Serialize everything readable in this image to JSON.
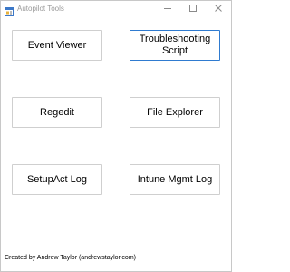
{
  "window": {
    "title": "Autopilot Tools"
  },
  "buttons": {
    "event_viewer": "Event Viewer",
    "troubleshooting_script": "Troubleshooting Script",
    "regedit": "Regedit",
    "file_explorer": "File Explorer",
    "setupact_log": "SetupAct Log",
    "intune_mgmt_log": "Intune Mgmt Log"
  },
  "footer": {
    "credit": "Created by Andrew Taylor (andrewstaylor.com)"
  },
  "colors": {
    "focus_border": "#2f7bd0",
    "button_border": "#cfcfcf",
    "title_text": "#9a9a9a"
  },
  "icons": {
    "app": "app-form-icon",
    "minimize": "minimize-icon",
    "maximize": "maximize-icon",
    "close": "close-icon"
  }
}
